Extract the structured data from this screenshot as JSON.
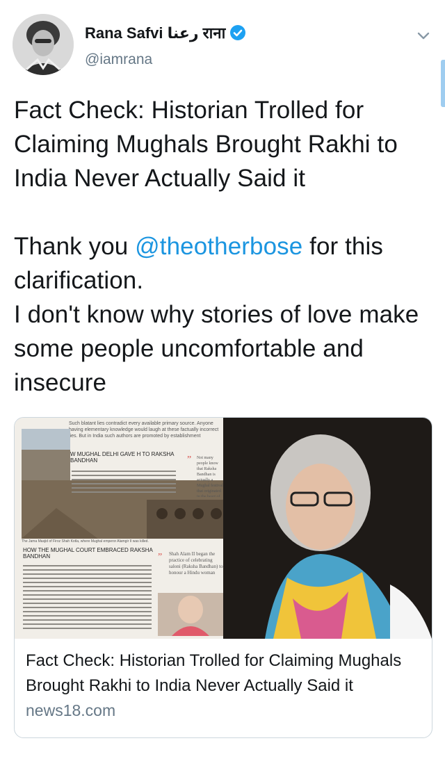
{
  "author": {
    "name": "Rana Safvi رعنا राना",
    "handle": "@iamrana",
    "verified": true
  },
  "tweet": {
    "line1": "Fact Check: Historian Trolled for Claiming Mughals Brought Rakhi to India Never Actually Said it",
    "thanks_prefix": "Thank you ",
    "mention": "@theotherbose",
    "thanks_suffix": " for this clarification.",
    "line3": "I don't know why stories of love make some people uncomfortable and insecure"
  },
  "card": {
    "title": "Fact Check: Historian Trolled for Claiming Mughals Brought Rakhi to India Never Actually Said it",
    "domain": "news18.com",
    "image": {
      "top_note": "Such blatant lies contradict every available primary source. Anyone having elementary knowledge would laugh at these factually incorrect lies. But in India such authors are promoted by establishment",
      "headline1": "W MUGHAL DELHI GAVE H TO RAKSHA BANDHAN",
      "quote1": "Not many people know that Raksha Bandhan is actually a Mughal festival that originated in the heart of Delhi",
      "caption1": "The Jama Masjid of Firoz Shah Kotla, where Mughal emperor Alamgir II was killed.",
      "headline2": "HOW THE MUGHAL COURT EMBRACED RAKSHA BANDHAN",
      "quote2": "Shah Alam II began the practice of celebrating saloni (Raksha Bandhan) to honour a Hindu woman"
    }
  },
  "colors": {
    "link": "#1b95e0",
    "verified": "#1da1f2",
    "text": "#14171a",
    "secondary": "#657786"
  }
}
